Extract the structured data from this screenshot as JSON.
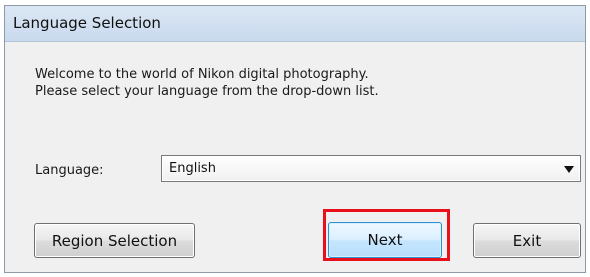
{
  "window": {
    "title": "Language Selection"
  },
  "message": {
    "line_1": "Welcome to the world of Nikon digital photography.",
    "line_2": "Please select your language from the drop-down list."
  },
  "language": {
    "label": "Language:",
    "selected_value": "English",
    "dropdown_icon": "chevron-down-icon"
  },
  "buttons": {
    "region_selection": "Region Selection",
    "next": "Next",
    "exit": "Exit"
  },
  "colors": {
    "highlight": "#e8101b",
    "focused_button_border": "#2f8fd3"
  }
}
